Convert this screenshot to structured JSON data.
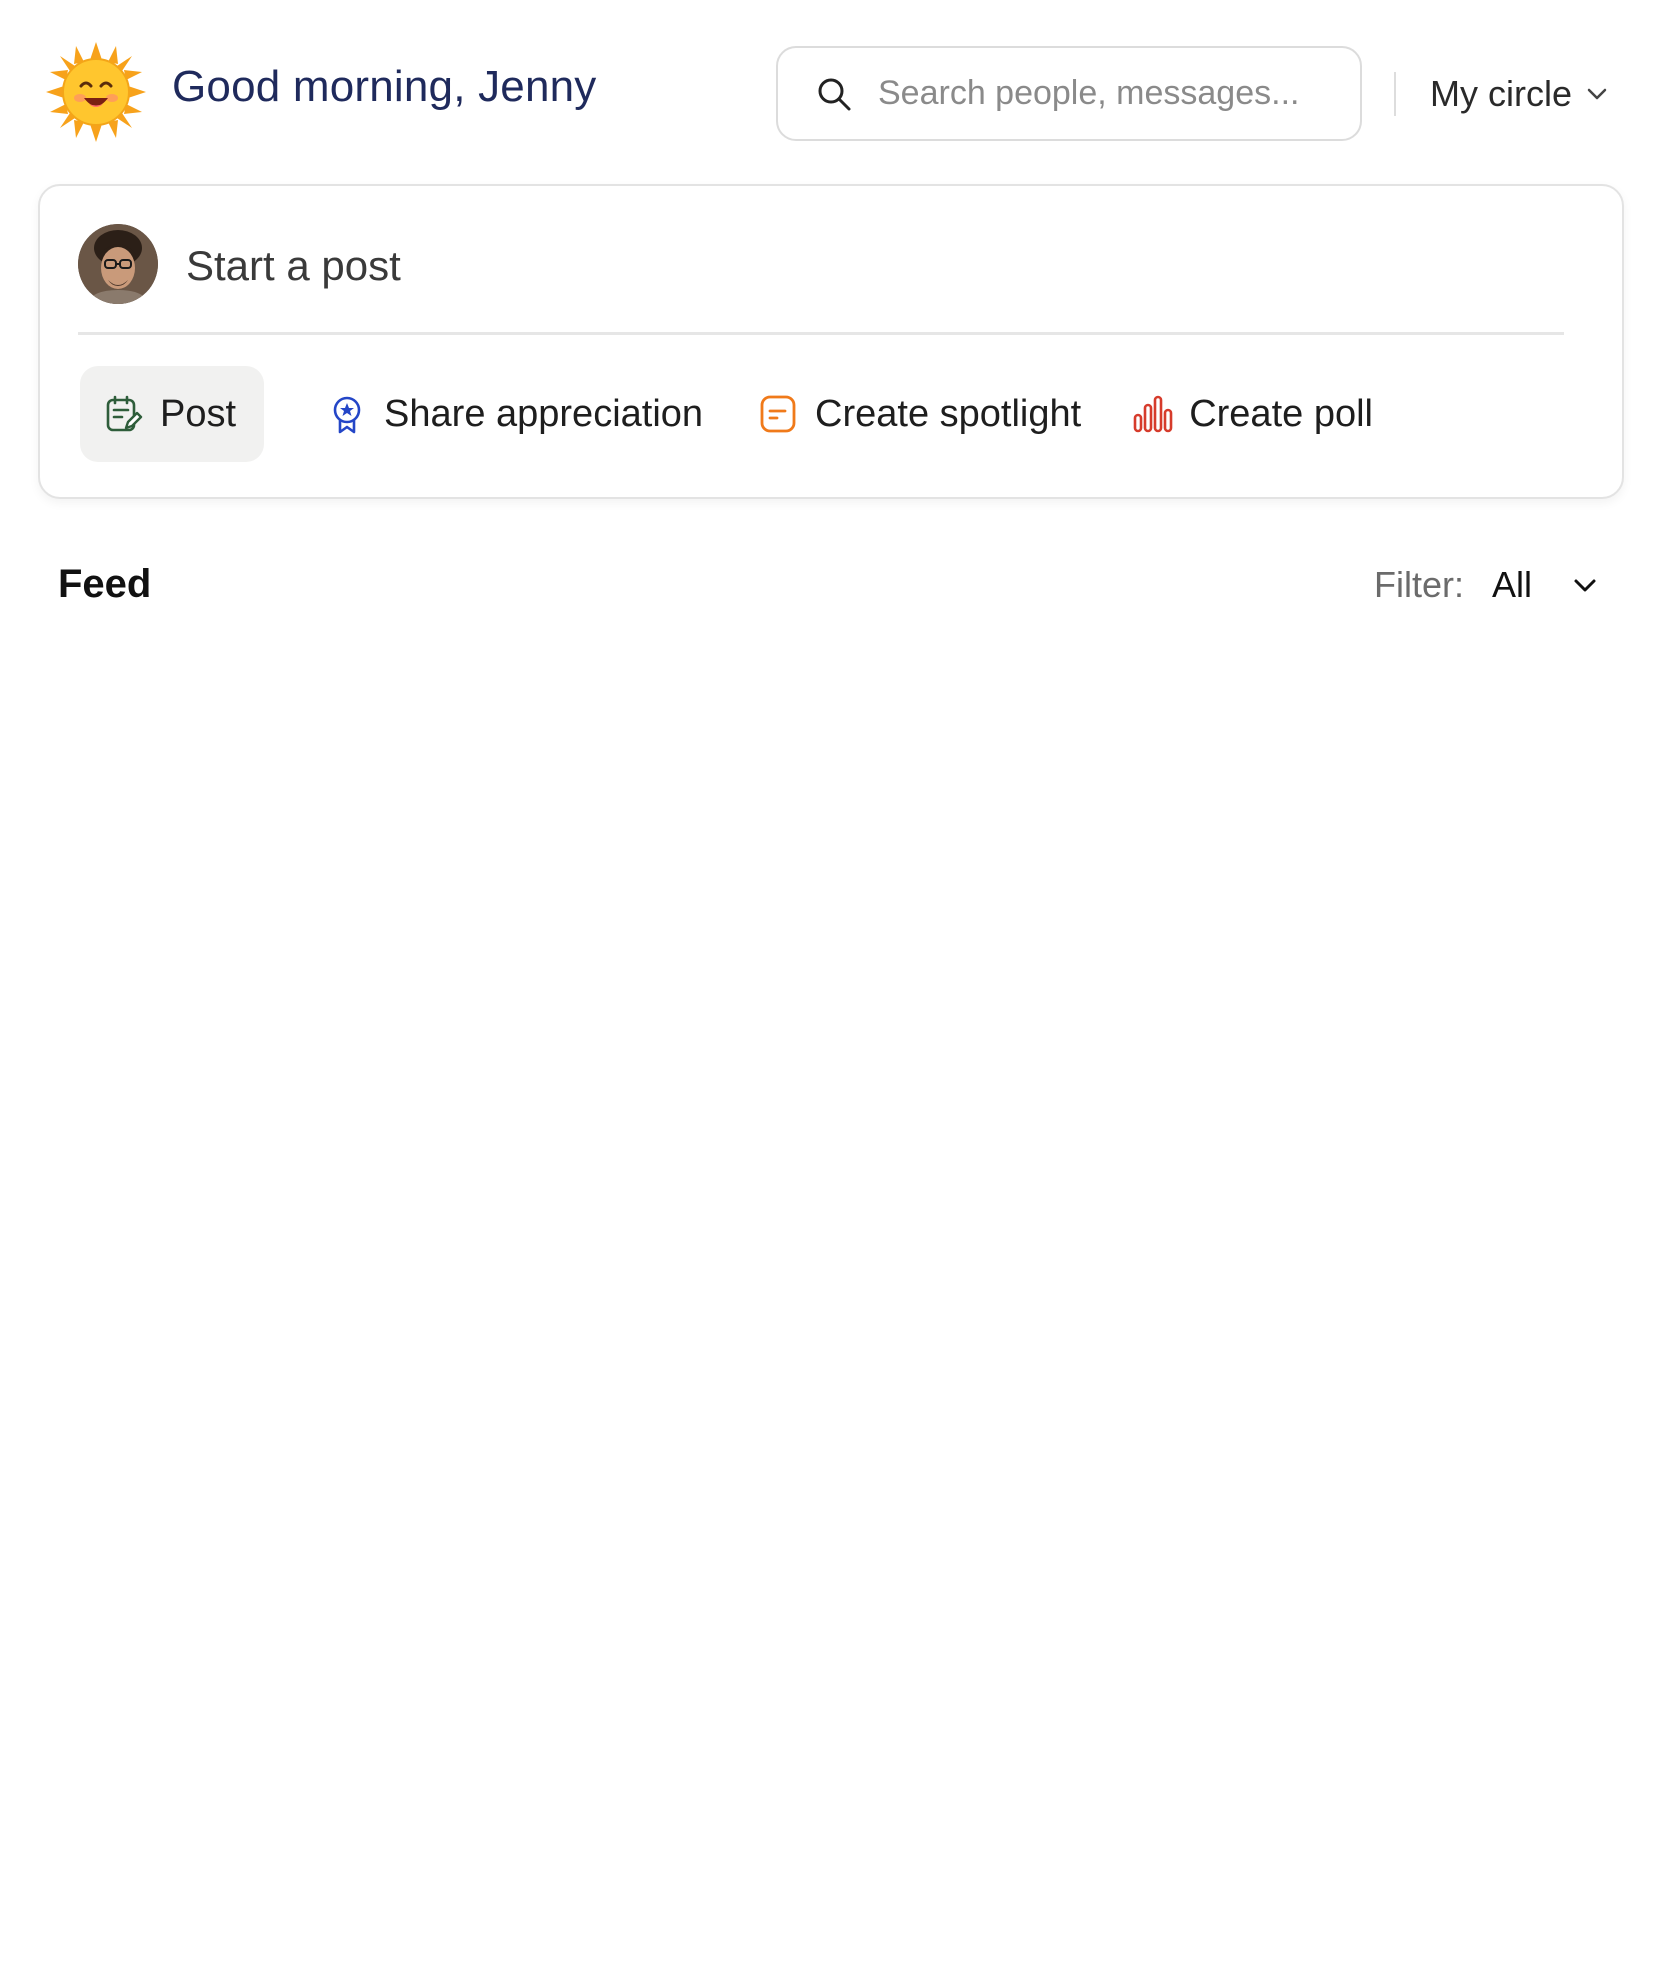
{
  "header": {
    "greeting": "Good morning, Jenny",
    "sun_icon": "sun-emoji-icon",
    "search": {
      "placeholder": "Search people, messages...",
      "value": "",
      "icon": "search-icon"
    },
    "circle_selector": {
      "label": "My circle",
      "icon": "chevron-down-icon"
    }
  },
  "composer": {
    "avatar_icon": "user-avatar",
    "prompt": "Start a post",
    "actions": [
      {
        "label": "Post",
        "icon": "edit-note-icon",
        "color": "#2e5d3a",
        "active": true
      },
      {
        "label": "Share appreciation",
        "icon": "award-badge-icon",
        "color": "#2446c7",
        "active": false
      },
      {
        "label": "Create spotlight",
        "icon": "spotlight-card-icon",
        "color": "#f07a1a",
        "active": false
      },
      {
        "label": "Create poll",
        "icon": "bar-chart-icon",
        "color": "#d63b2b",
        "active": false
      }
    ]
  },
  "feed": {
    "title": "Feed",
    "filter": {
      "label": "Filter:",
      "value": "All",
      "icon": "chevron-down-icon"
    },
    "items": []
  }
}
